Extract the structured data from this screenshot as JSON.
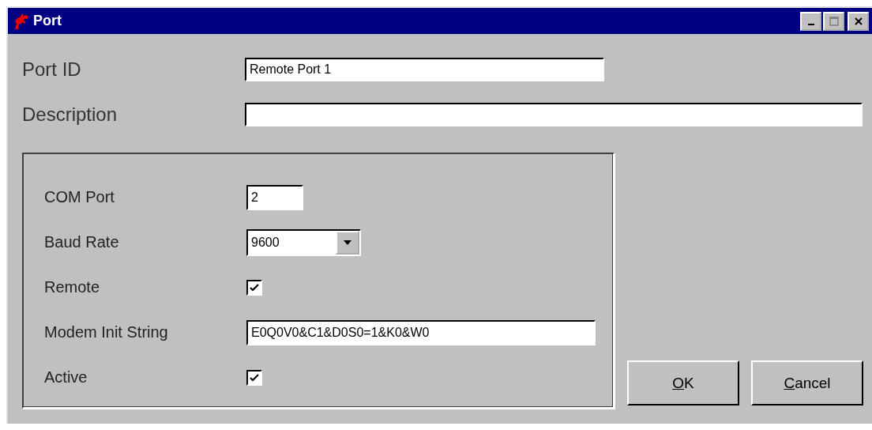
{
  "window": {
    "title": "Port"
  },
  "fields": [
    {
      "label": "Port ID",
      "value": "Remote Port 1"
    },
    {
      "label": "Description"
    }
  ],
  "group": {
    "rows": [
      {
        "kind": "text",
        "label": "COM Port",
        "value": "2"
      },
      {
        "kind": "combo",
        "label": "Baud Rate",
        "value": "9600"
      },
      {
        "kind": "checkbox",
        "label": "Remote",
        "checked": true
      },
      {
        "kind": "text",
        "label": "Modem Init String",
        "value": "E0Q0V0&C1&D0S0=1&K0&W0"
      },
      {
        "kind": "checkbox",
        "label": "Active",
        "checked": true
      }
    ]
  },
  "buttons": [
    "OK",
    "Cancel"
  ]
}
